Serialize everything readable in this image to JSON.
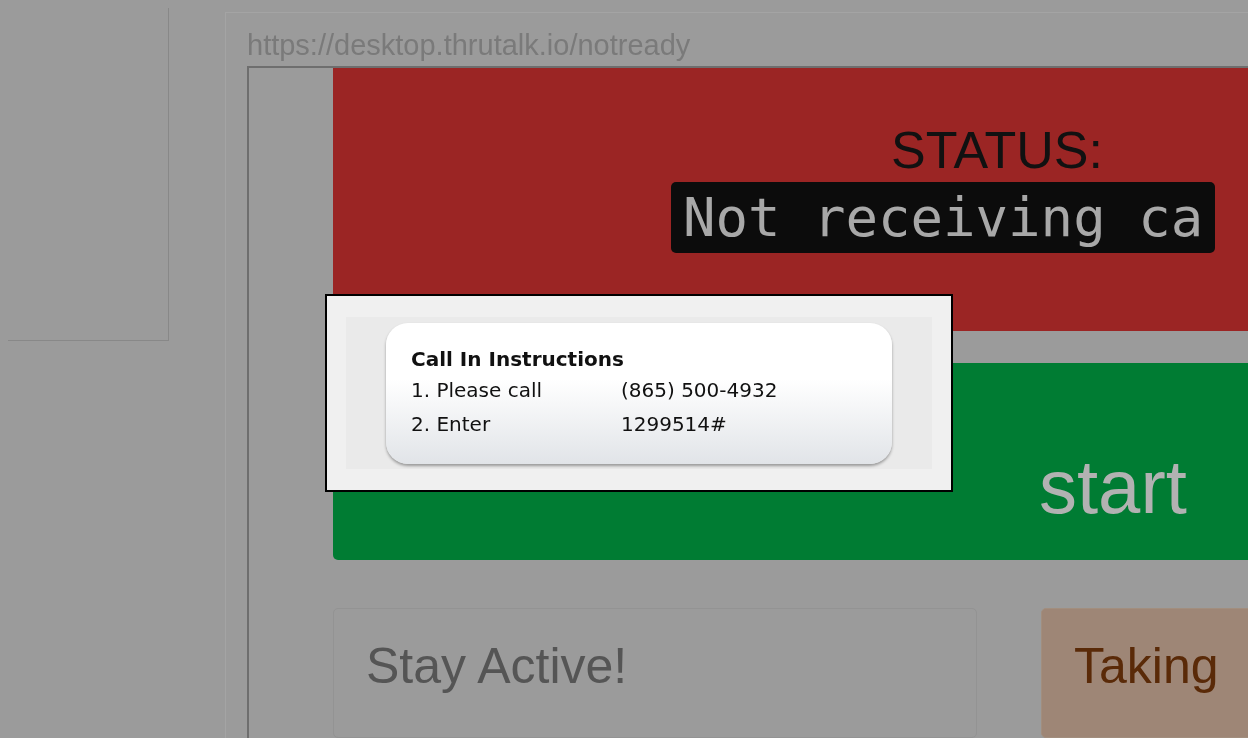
{
  "browser": {
    "url": "https://desktop.thrutalk.io/notready"
  },
  "status_panel": {
    "label": "STATUS:",
    "value": "Not receiving ca"
  },
  "start_button": {
    "label": "start"
  },
  "cards": [
    {
      "title": "Stay Active!",
      "kind": "plain"
    },
    {
      "title": "Taking",
      "kind": "warning"
    }
  ],
  "dialog": {
    "title": "Call In Instructions",
    "steps": [
      {
        "label": "1. Please call",
        "value": "(865) 500-4932"
      },
      {
        "label": "2. Enter",
        "value": "1299514#"
      }
    ]
  }
}
